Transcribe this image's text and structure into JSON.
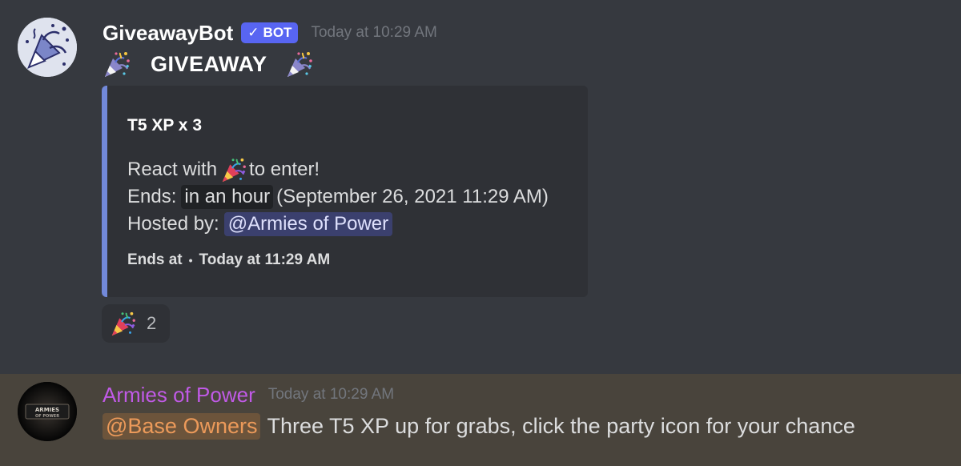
{
  "messages": [
    {
      "author": "GiveawayBot",
      "bot_tag": "BOT",
      "bot_check": "✓",
      "timestamp": "Today at 10:29 AM",
      "avatar_icon": "party-popper-icon",
      "content_title": "GIVEAWAY",
      "embed": {
        "accent_color": "#7289da",
        "title": "T5 XP x 3",
        "react_prefix": "React with",
        "react_suffix": "to enter!",
        "ends_label": "Ends:",
        "ends_relative": "in an hour",
        "ends_absolute": "(September 26, 2021 11:29 AM)",
        "hosted_label": "Hosted by:",
        "host_mention": "@Armies of Power",
        "footer_label": "Ends at",
        "footer_separator": "•",
        "footer_time": "Today at 11:29 AM"
      },
      "reactions": [
        {
          "emoji": "party-popper-icon",
          "count": "2"
        }
      ]
    },
    {
      "author": "Armies of Power",
      "author_color": "#c05ae6",
      "timestamp": "Today at 10:29 AM",
      "avatar_text": "ARMIES OF POWER",
      "role_mention": "@Base Owners",
      "role_mention_color": "#ec9a5a",
      "text": "Three T5 XP up for grabs, click the party icon for your chance",
      "highlight_color": "#49443c"
    }
  ],
  "colors": {
    "background": "#36393f",
    "embed_background": "#2f3136",
    "bot_tag": "#5865f2",
    "timestamp": "#72767d"
  }
}
